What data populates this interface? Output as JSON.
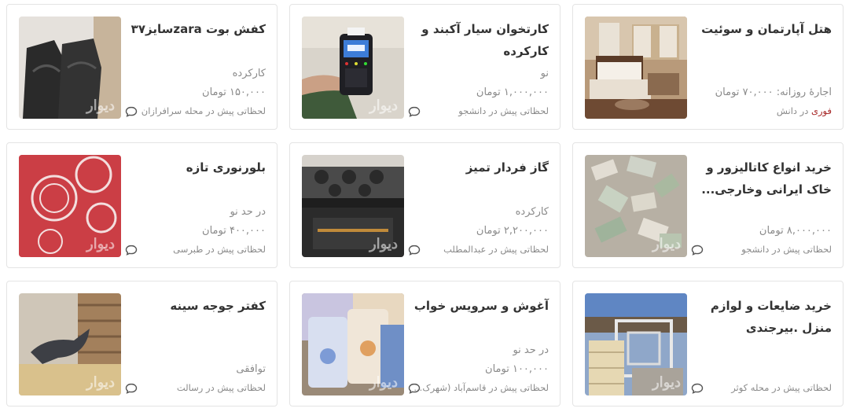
{
  "watermark": "دیوار",
  "cards": [
    {
      "title": "هتل آپارتمان و سوئیت",
      "desc1": "",
      "desc2": "اجارهٔ روزانه: ۷۰,۰۰۰ تومان",
      "meta_prefix": "فوری",
      "meta": " در دانش"
    },
    {
      "title": "کارتخوان سیار آکبند و کارکرده",
      "desc1": "نو",
      "desc2": "۱,۰۰۰,۰۰۰ تومان",
      "meta_prefix": "",
      "meta": "لحظاتی پیش در دانشجو"
    },
    {
      "title": "کفش بوت zaraسایز۳۷",
      "desc1": "کارکرده",
      "desc2": "۱۵۰,۰۰۰ تومان",
      "meta_prefix": "",
      "meta": "لحظاتی پیش در محله سرافرازان"
    },
    {
      "title": "خرید انواع کاتالیزور و خاک ایرانی وخارجی...",
      "desc1": "",
      "desc2": "۸,۰۰۰,۰۰۰ تومان",
      "meta_prefix": "",
      "meta": "لحظاتی پیش در دانشجو"
    },
    {
      "title": "گاز فردار تمیز",
      "desc1": "کارکرده",
      "desc2": "۲,۲۰۰,۰۰۰ تومان",
      "meta_prefix": "",
      "meta": "لحظاتی پیش در عبدالمطلب"
    },
    {
      "title": "بلورنوری تازه",
      "desc1": "در حد نو",
      "desc2": "۴۰۰,۰۰۰ تومان",
      "meta_prefix": "",
      "meta": "لحظاتی پیش در طبرسی"
    },
    {
      "title": "خرید ضایعات و لوازم منزل .بیرجندی",
      "desc1": "",
      "desc2": "",
      "meta_prefix": "",
      "meta": "لحظاتی پیش در محله کوثر"
    },
    {
      "title": "آغوش و سرویس خواب",
      "desc1": "در حد نو",
      "desc2": "۱۰۰,۰۰۰ تومان",
      "meta_prefix": "",
      "meta": "لحظاتی پیش در قاسم‌آباد (شهرک..."
    },
    {
      "title": "کفتر جوجه سینه",
      "desc1": "",
      "desc2": "توافقی",
      "meta_prefix": "",
      "meta": "لحظاتی پیش در رسالت"
    }
  ],
  "icons": {
    "chat": "chat-bubble-icon"
  },
  "colors": {
    "urgent": "#a62626",
    "muted": "#8a8a8a",
    "title": "#333333",
    "border": "#e4e4e4"
  }
}
